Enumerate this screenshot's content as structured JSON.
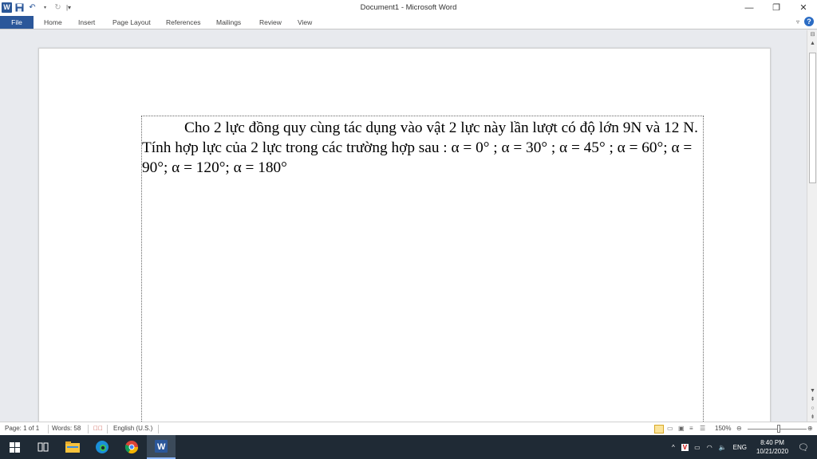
{
  "window": {
    "title": "Document1  -  Microsoft Word",
    "minimize": "—",
    "maximize": "❐",
    "close": "✕"
  },
  "ribbon": {
    "tabs": [
      "File",
      "Home",
      "Insert",
      "Page Layout",
      "References",
      "Mailings",
      "Review",
      "View"
    ],
    "help": "?"
  },
  "document": {
    "text": "Cho 2 lực đồng quy cùng tác dụng vào vật 2 lực này lần lượt có độ lớn 9N và 12 N. Tính hợp lực của 2 lực trong các trường hợp sau : α = 0° ; α = 30° ; α = 45° ; α = 60°; α = 90°; α = 120°; α = 180°"
  },
  "status": {
    "page": "Page: 1 of 1",
    "words": "Words: 58",
    "language": "English (U.S.)",
    "zoom": "150%"
  },
  "taskbar": {
    "language": "ENG",
    "time": "8:40 PM",
    "date": "10/21/2020"
  },
  "colors": {
    "file_tab": "#2b579a",
    "taskbar": "#1f2a35"
  }
}
